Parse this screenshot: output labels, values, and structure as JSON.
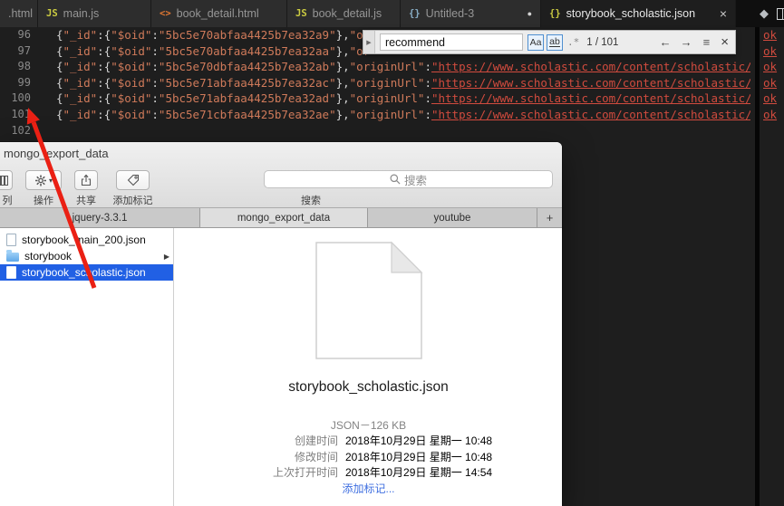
{
  "editor": {
    "tabs": [
      {
        "label": ".html"
      },
      {
        "label": "main.js",
        "icon": "JS"
      },
      {
        "label": "book_detail.html",
        "icon": "<>"
      },
      {
        "label": "book_detail.js",
        "icon": "JS"
      },
      {
        "label": "Untitled-3",
        "icon": "{}",
        "dirty": "●"
      },
      {
        "label": "storybook_scholastic.json",
        "icon": "{}",
        "close": "×"
      }
    ],
    "actions": {
      "diamond": "◆"
    },
    "find": {
      "toggle": "▶",
      "query": "recommend",
      "match_case": "Aa",
      "whole_word": "ab",
      "regex": ".*",
      "results": "1 / 101",
      "prev": "←",
      "next": "→",
      "selection": "≡",
      "close": "×"
    },
    "lines": [
      {
        "num": "96",
        "text": "{\"_id\":{\"$oid\":\"5bc5e70abfaa4425b7ea32a9\"},\"or"
      },
      {
        "num": "97",
        "text": "{\"_id\":{\"$oid\":\"5bc5e70abfaa4425b7ea32aa\"},\"or"
      },
      {
        "num": "98",
        "text": "{\"_id\":{\"$oid\":\"5bc5e70dbfaa4425b7ea32ab\"},\"originUrl\":\"https://www.scholastic.com/content/scholastic/book"
      },
      {
        "num": "99",
        "text": "{\"_id\":{\"$oid\":\"5bc5e71abfaa4425b7ea32ac\"},\"originUrl\":\"https://www.scholastic.com/content/scholastic/book"
      },
      {
        "num": "100",
        "text": "{\"_id\":{\"$oid\":\"5bc5e71abfaa4425b7ea32ad\"},\"originUrl\":\"https://www.scholastic.com/content/scholastic/book"
      },
      {
        "num": "101",
        "text": "{\"_id\":{\"$oid\":\"5bc5e71cbfaa4425b7ea32ae\"},\"originUrl\":\"https://www.scholastic.com/content/scholastic/book"
      },
      {
        "num": "102",
        "text": ""
      }
    ],
    "overflow_fragments": [
      "ok",
      "ok",
      "ok",
      "ok",
      "ok",
      "ok"
    ]
  },
  "finder": {
    "title": "mongo_export_data",
    "toolbar": {
      "view_label": "列",
      "action_label": "操作",
      "share_label": "共享",
      "tag_label": "添加标记",
      "search_placeholder": "搜索",
      "search_label": "搜索"
    },
    "tabs": [
      "jquery-3.3.1",
      "mongo_export_data",
      "youtube"
    ],
    "new_tab": "+",
    "files": [
      {
        "name": "storybook_main_200.json",
        "type": "file"
      },
      {
        "name": "storybook",
        "type": "folder",
        "disclosure": "▶"
      },
      {
        "name": "storybook_scholastic.json",
        "type": "file",
        "selected": true
      }
    ],
    "preview": {
      "filename": "storybook_scholastic.json",
      "kind_size": "JSON－126 KB",
      "meta": [
        {
          "label": "创建时间",
          "value": "2018年10月29日 星期一 10:48"
        },
        {
          "label": "修改时间",
          "value": "2018年10月29日 星期一 10:48"
        },
        {
          "label": "上次打开时间",
          "value": "2018年10月29日 星期一 14:54"
        }
      ],
      "add_tags": "添加标记..."
    }
  },
  "colors": {
    "selection_blue": "#2160e4",
    "arrow_red": "#ea2014",
    "string_orange": "#cf7a5a",
    "url_red": "#d14b3e",
    "tag_link_blue": "#3f6fe0"
  }
}
